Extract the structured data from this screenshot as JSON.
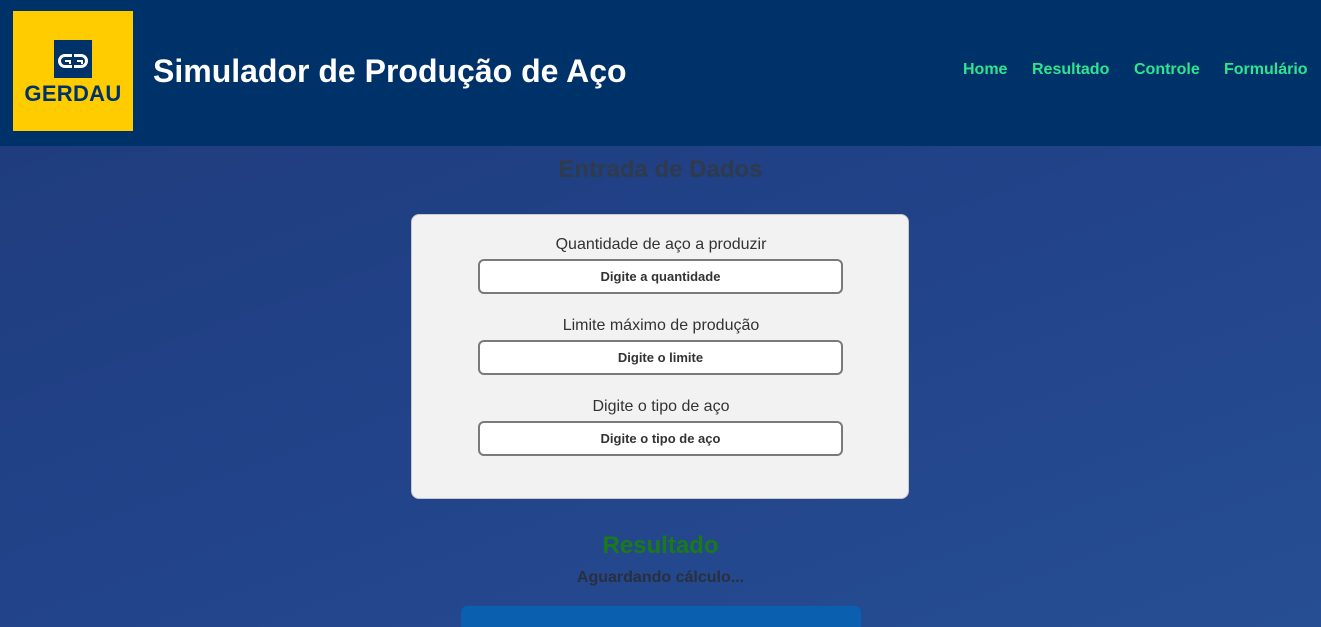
{
  "brand": {
    "logo_text": "GERDAU",
    "logo_bg_color": "#ffcc00",
    "logo_fg_color": "#00326a"
  },
  "header": {
    "title": "Simulador de Produção de Aço",
    "bg_color": "#00326a"
  },
  "nav": {
    "items": [
      "Home",
      "Resultado",
      "Controle",
      "Formulário"
    ],
    "link_color": "#2ee58f"
  },
  "form_section": {
    "title": "Entrada de Dados",
    "fields": [
      {
        "label": "Quantidade de aço a produzir",
        "placeholder": "Digite a quantidade",
        "value": ""
      },
      {
        "label": "Limite máximo de produção",
        "placeholder": "Digite o limite",
        "value": ""
      },
      {
        "label": "Digite o tipo de aço",
        "placeholder": "Digite o tipo de aço",
        "value": ""
      }
    ]
  },
  "result_section": {
    "title": "Resultado",
    "title_color": "#1a7a1a",
    "status": "Aguardando cálculo...",
    "button_color": "#0a5fae"
  },
  "icons": {
    "logo": "gerdau-gg-logo-icon"
  }
}
